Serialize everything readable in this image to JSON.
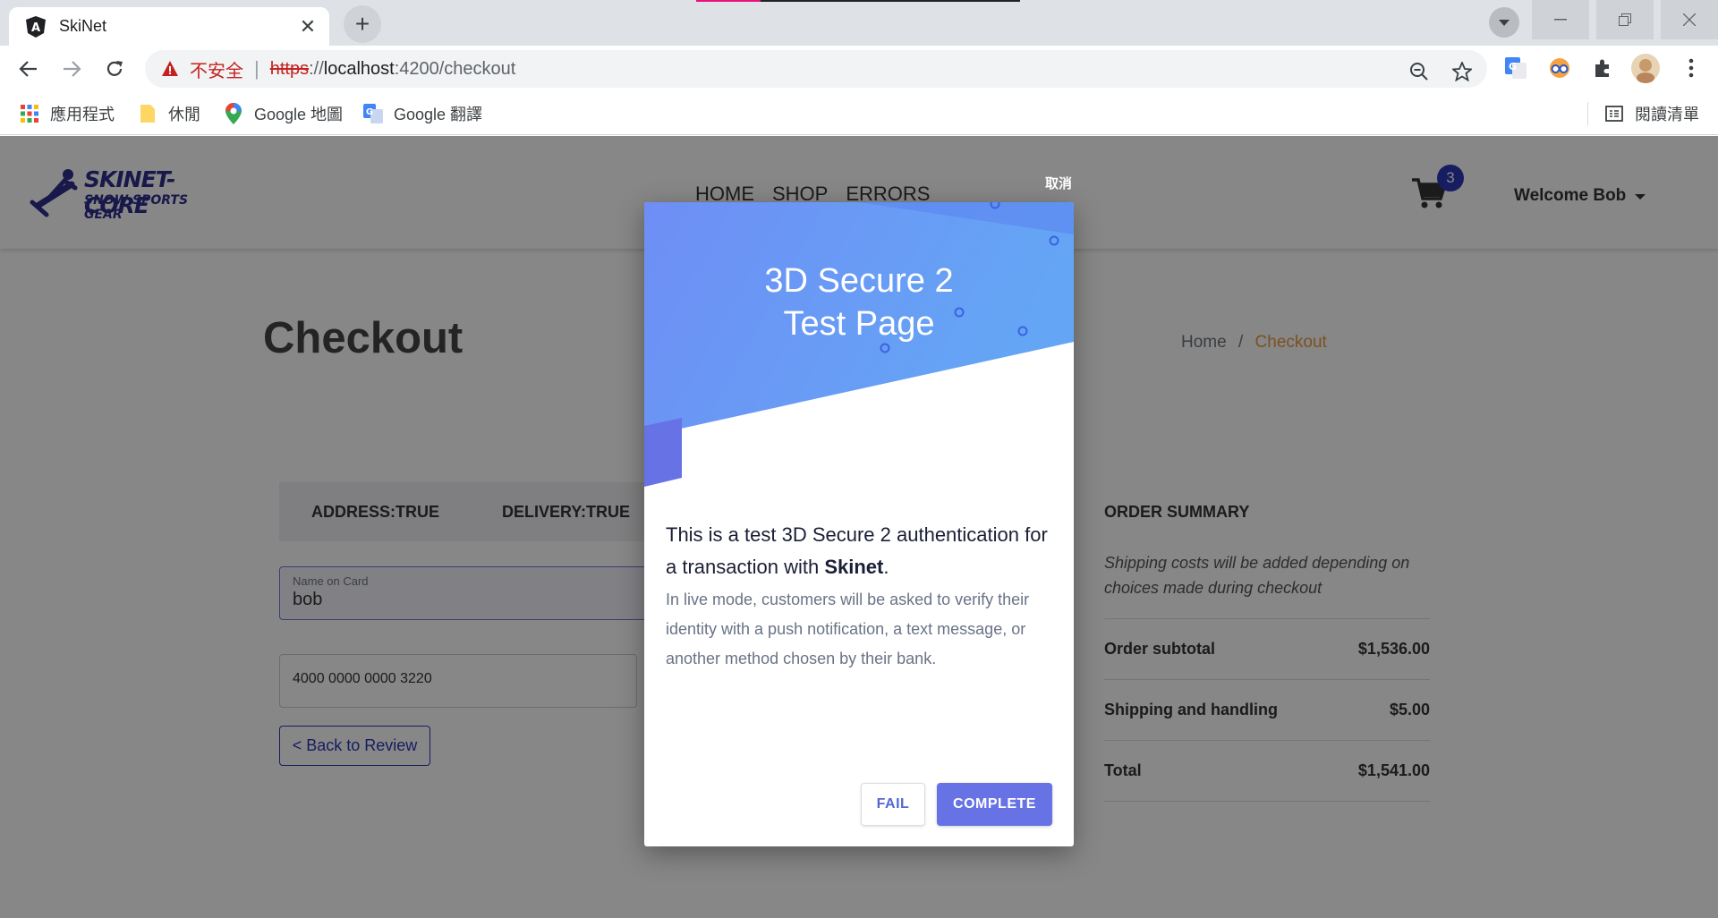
{
  "browser": {
    "tab_title": "SkiNet",
    "tab_close": "✕",
    "new_tab": "+",
    "omnibox": {
      "security_label": "不安全",
      "separator": "|",
      "scheme": "https",
      "url_sep": "://",
      "host": "localhost",
      "port": ":4200",
      "path": "/checkout"
    },
    "bookmarks": [
      {
        "label": "應用程式",
        "icon": "apps-grid-icon"
      },
      {
        "label": "休閒",
        "icon": "folder-icon"
      },
      {
        "label": "Google 地圖",
        "icon": "google-maps-icon"
      },
      {
        "label": "Google 翻譯",
        "icon": "google-translate-icon"
      }
    ],
    "reading_list": "閱讀清單"
  },
  "site": {
    "logo_line1": "SKINET-CORE",
    "logo_line2": "SNOW SPORTS GEAR",
    "nav": [
      "HOME",
      "SHOP",
      "ERRORS"
    ],
    "cart_count": "3",
    "welcome": "Welcome Bob",
    "page_title": "Checkout",
    "breadcrumb_home": "Home",
    "breadcrumb_sep": "/",
    "breadcrumb_current": "Checkout",
    "steps": [
      "ADDRESS:TRUE",
      "DELIVERY:TRUE"
    ],
    "name_on_card_label": "Name on Card",
    "name_on_card_value": "bob",
    "card_number": "4000 0000 0000 3220",
    "back_button": "< Back to Review",
    "summary": {
      "heading": "ORDER SUMMARY",
      "note": "Shipping costs will be added depending on choices made during checkout",
      "rows": [
        {
          "label": "Order subtotal",
          "value": "$1,536.00"
        },
        {
          "label": "Shipping and handling",
          "value": "$5.00"
        },
        {
          "label": "Total",
          "value": "$1,541.00"
        }
      ]
    }
  },
  "modal": {
    "cancel": "取消",
    "title_line1": "3D Secure 2",
    "title_line2": "Test Page",
    "lead_text": "This is a test 3D Secure 2 authentication for a transaction with ",
    "merchant": "Skinet",
    "lead_end": ".",
    "sub_text": "In live mode, customers will be asked to verify their identity with a push notification, a text message, or another method chosen by their bank.",
    "fail_button": "FAIL",
    "complete_button": "COMPLETE"
  },
  "colors": {
    "hero_gradient_start": "#6e8ef5",
    "hero_gradient_end": "#64a6f5",
    "accent": "#6772e5",
    "brand_nav": "#2d37b8",
    "breadcrumb_active": "#e99a3b"
  }
}
